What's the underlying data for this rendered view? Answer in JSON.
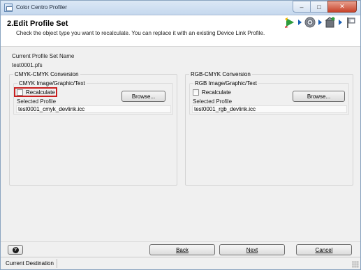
{
  "window": {
    "title": "Color Centro Profiler"
  },
  "header": {
    "title": "2.Edit Profile Set",
    "description": "Check the object type you want to recalculate. You can replace it with an existing Device Link Profile.",
    "steps": [
      "wizard-start-icon",
      "gear-icon",
      "box-icon",
      "finish-flag-icon"
    ]
  },
  "profile_set": {
    "label": "Current Profile Set Name",
    "value": "test0001.pfs"
  },
  "cmyk_group": {
    "title": "CMYK-CMYK Conversion",
    "sub_title": "CMYK Image/Graphic/Text",
    "recalculate_label": "Recalculate",
    "recalculate_checked": false,
    "browse_label": "Browse...",
    "selected_label": "Selected Profile",
    "selected_value": "test0001_cmyk_devlink.icc"
  },
  "rgb_group": {
    "title": "RGB-CMYK Conversion",
    "sub_title": "RGB Image/Graphic/Text",
    "recalculate_label": "Recalculate",
    "recalculate_checked": false,
    "browse_label": "Browse...",
    "selected_label": "Selected Profile",
    "selected_value": "test0001_rgb_devlink.icc"
  },
  "footer": {
    "back_label": "Back",
    "next_label": "Next",
    "cancel_label": "Cancel"
  },
  "statusbar": {
    "text": "Current Destination"
  },
  "colors": {
    "highlight": "#c81e1e",
    "accent": "#1a5fb4"
  }
}
